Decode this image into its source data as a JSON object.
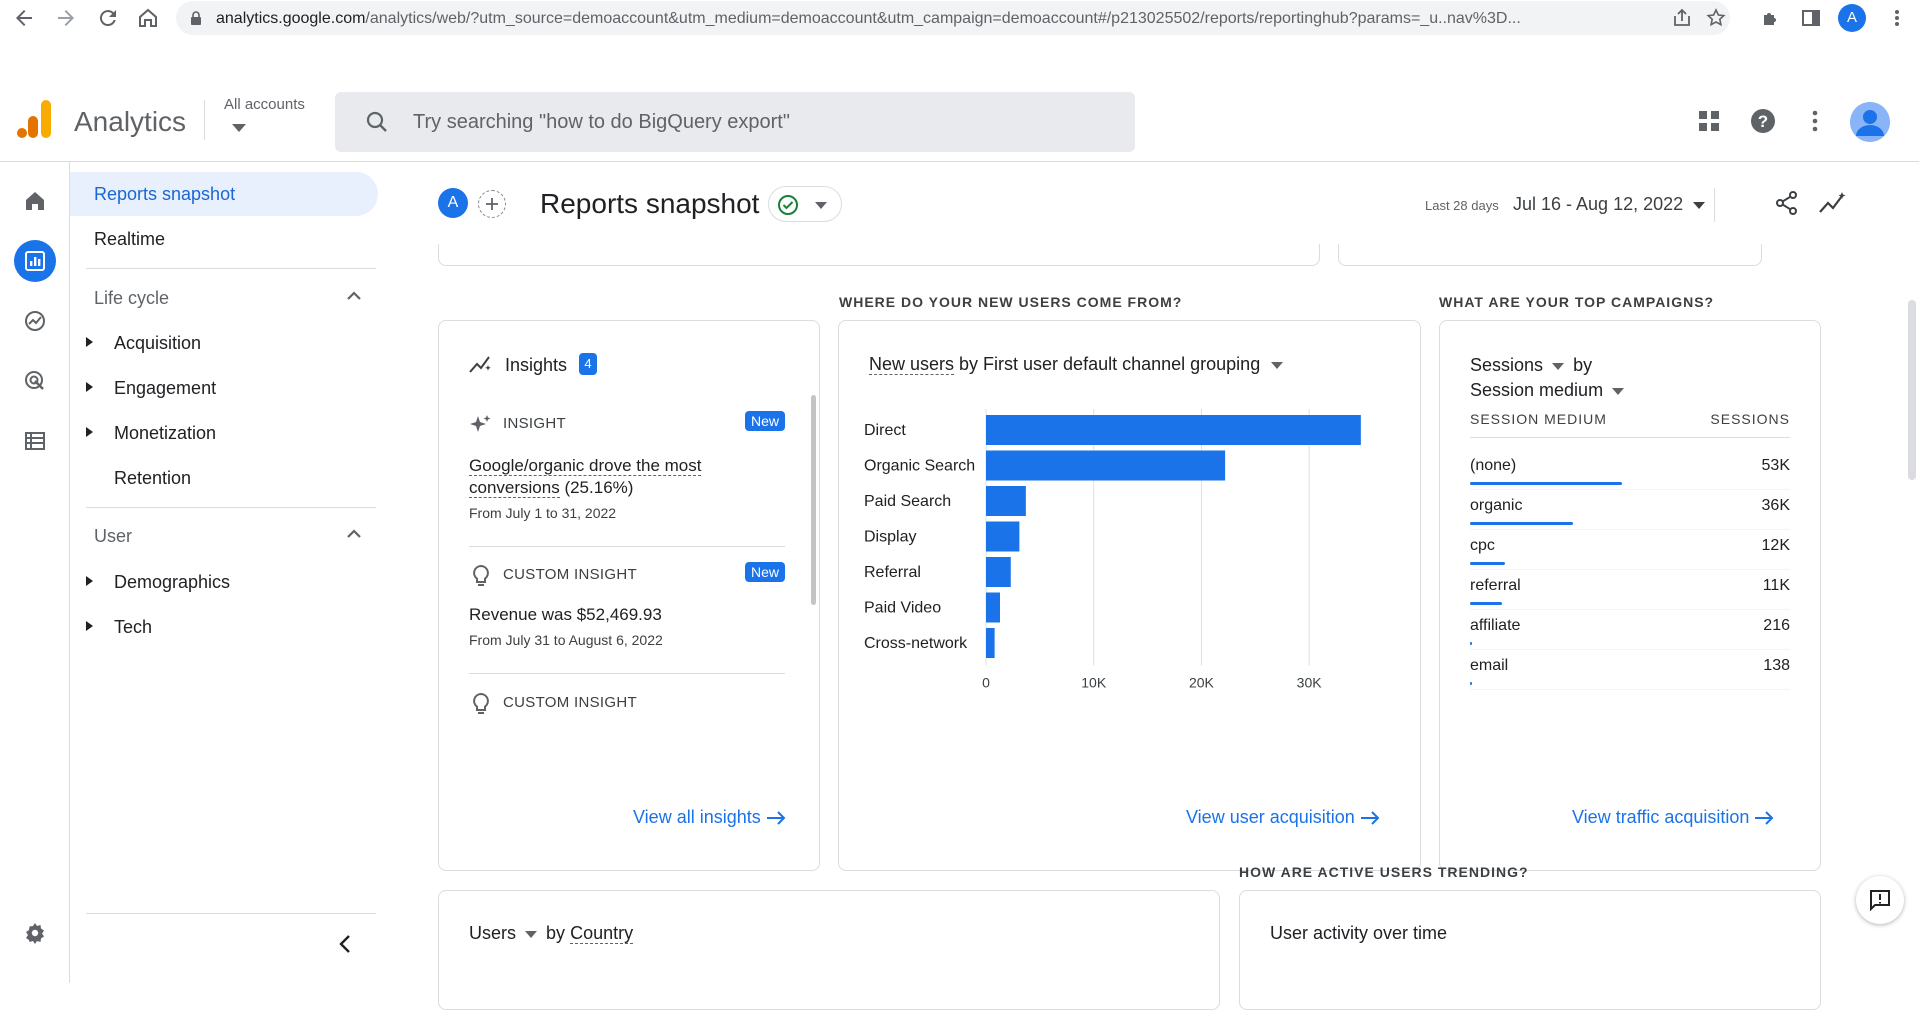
{
  "browser": {
    "url_host": "analytics.google.com",
    "url_rest": "/analytics/web/?utm_source=demoaccount&utm_medium=demoaccount&utm_campaign=demoaccount#/p213025502/reports/reportinghub?params=_u..nav%3D...",
    "profile_initial": "A"
  },
  "header": {
    "app_name": "Analytics",
    "account_selector": "All accounts",
    "search_placeholder": "Try searching \"how to do BigQuery export\""
  },
  "nav": {
    "reports_snapshot": "Reports snapshot",
    "realtime": "Realtime",
    "lifecycle": {
      "title": "Life cycle",
      "items": [
        "Acquisition",
        "Engagement",
        "Monetization",
        "Retention"
      ]
    },
    "user": {
      "title": "User",
      "items": [
        "Demographics",
        "Tech"
      ]
    }
  },
  "toolbar": {
    "property_initial": "A",
    "page_title": "Reports snapshot",
    "date_label": "Last 28 days",
    "date_range": "Jul 16 - Aug 12, 2022"
  },
  "sections": {
    "new_users": "WHERE DO YOUR NEW USERS COME FROM?",
    "campaigns": "WHAT ARE YOUR TOP CAMPAIGNS?",
    "active_users": "HOW ARE ACTIVE USERS TRENDING?"
  },
  "insights": {
    "title": "Insights",
    "count": "4",
    "items": [
      {
        "type": "INSIGHT",
        "badge": "New",
        "headline_underlined": "Google/organic drove the most conversions",
        "headline_rest": " (25.16%)",
        "sub": "From July 1 to 31, 2022"
      },
      {
        "type": "CUSTOM INSIGHT",
        "badge": "New",
        "headline": "Revenue was $52,469.93",
        "sub": "From July 31 to August 6, 2022"
      },
      {
        "type": "CUSTOM INSIGHT"
      }
    ],
    "link": "View all insights"
  },
  "new_users_card": {
    "metric": "New users",
    "by": " by First user default channel grouping",
    "link": "View user acquisition"
  },
  "campaigns_card": {
    "metric": "Sessions",
    "by": "by",
    "dimension": "Session medium",
    "col_dimension": "SESSION MEDIUM",
    "col_metric": "SESSIONS",
    "rows": [
      {
        "name": "(none)",
        "value": "53K",
        "share": 1.0
      },
      {
        "name": "organic",
        "value": "36K",
        "share": 0.68
      },
      {
        "name": "cpc",
        "value": "12K",
        "share": 0.23
      },
      {
        "name": "referral",
        "value": "11K",
        "share": 0.21
      },
      {
        "name": "affiliate",
        "value": "216",
        "share": 0.004
      },
      {
        "name": "email",
        "value": "138",
        "share": 0.003
      }
    ],
    "link": "View traffic acquisition"
  },
  "country_card": {
    "metric": "Users",
    "by": "by",
    "dimension": "Country"
  },
  "activity_card": {
    "title": "User activity over time"
  },
  "colors": {
    "accent": "#1a73e8",
    "bar": "#1a73e8",
    "selected_bg": "#e8f0fe"
  },
  "chart_data": {
    "type": "bar",
    "orientation": "horizontal",
    "categories": [
      "Direct",
      "Organic Search",
      "Paid Search",
      "Display",
      "Referral",
      "Paid Video",
      "Cross-network"
    ],
    "values": [
      34800,
      22200,
      3700,
      3100,
      2300,
      1300,
      800
    ],
    "xlim": [
      0,
      35000
    ],
    "xticks": [
      0,
      10000,
      20000,
      30000
    ],
    "xtick_labels": [
      "0",
      "10K",
      "20K",
      "30K"
    ],
    "grid": true
  }
}
